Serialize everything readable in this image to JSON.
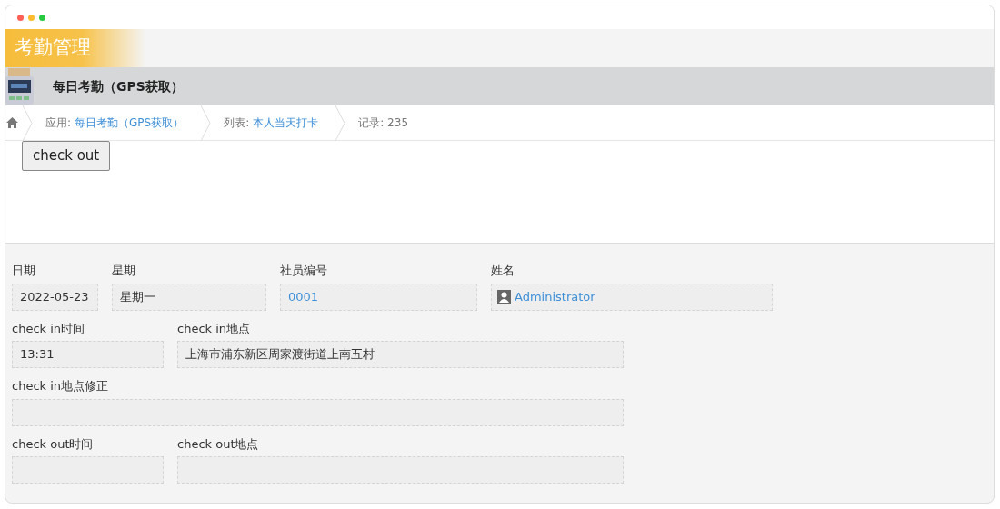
{
  "header": {
    "title": "考勤管理"
  },
  "page": {
    "title": "每日考勤（GPS获取）"
  },
  "breadcrumb": [
    {
      "label": "应用:",
      "link": "每日考勤（GPS获取）"
    },
    {
      "label": "列表:",
      "link": "本人当天打卡"
    },
    {
      "label": "记录: 235"
    }
  ],
  "action_button": "check out",
  "form_rows": [
    [
      {
        "label": "日期",
        "value": "2022-05-23",
        "kind": "text"
      },
      {
        "label": "星期",
        "value": "星期一",
        "kind": "text"
      },
      {
        "label": "社员编号",
        "value": "0001",
        "kind": "link"
      },
      {
        "label": "姓名",
        "value": "Administrator",
        "kind": "user"
      }
    ],
    [
      {
        "label": "check in时间",
        "value": "13:31",
        "kind": "text"
      },
      {
        "label": "check in地点",
        "value": "上海市浦东新区周家渡街道上南五村",
        "kind": "text"
      }
    ],
    [
      {
        "label": "check in地点修正"
      }
    ],
    [
      {
        "label": "check out时间"
      },
      {
        "label": "check out地点"
      }
    ]
  ]
}
